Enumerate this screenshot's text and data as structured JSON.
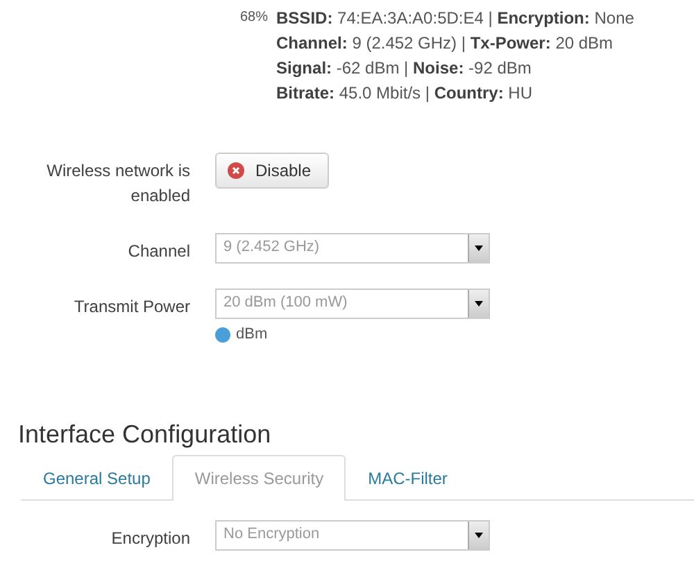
{
  "status": {
    "signal_percent": "68%",
    "lines": [
      "**BSSID:** 74:EA:3A:A0:5D:E4 | **Encryption:** None",
      "**Channel:** 9 (2.452 GHz) | **Tx-Power:** 20 dBm",
      "**Signal:** -62 dBm | **Noise:** -92 dBm",
      "**Bitrate:** 45.0 Mbit/s | **Country:** HU"
    ]
  },
  "fields": [
    {
      "kind": "button",
      "label": "Wireless network is enabled",
      "button": "Disable"
    },
    {
      "kind": "select",
      "label": "Channel",
      "value": "9 (2.452 GHz)"
    },
    {
      "kind": "select",
      "label": "Transmit Power",
      "value": "20 dBm (100 mW)",
      "hint": "dBm"
    }
  ],
  "section": {
    "title": "Interface Configuration",
    "tabs": [
      {
        "label": "General Setup",
        "selected": false
      },
      {
        "label": "Wireless Security",
        "selected": true
      },
      {
        "label": "MAC-Filter",
        "selected": false
      }
    ],
    "fields": [
      {
        "kind": "select",
        "label": "Encryption",
        "value": "No Encryption"
      }
    ]
  }
}
